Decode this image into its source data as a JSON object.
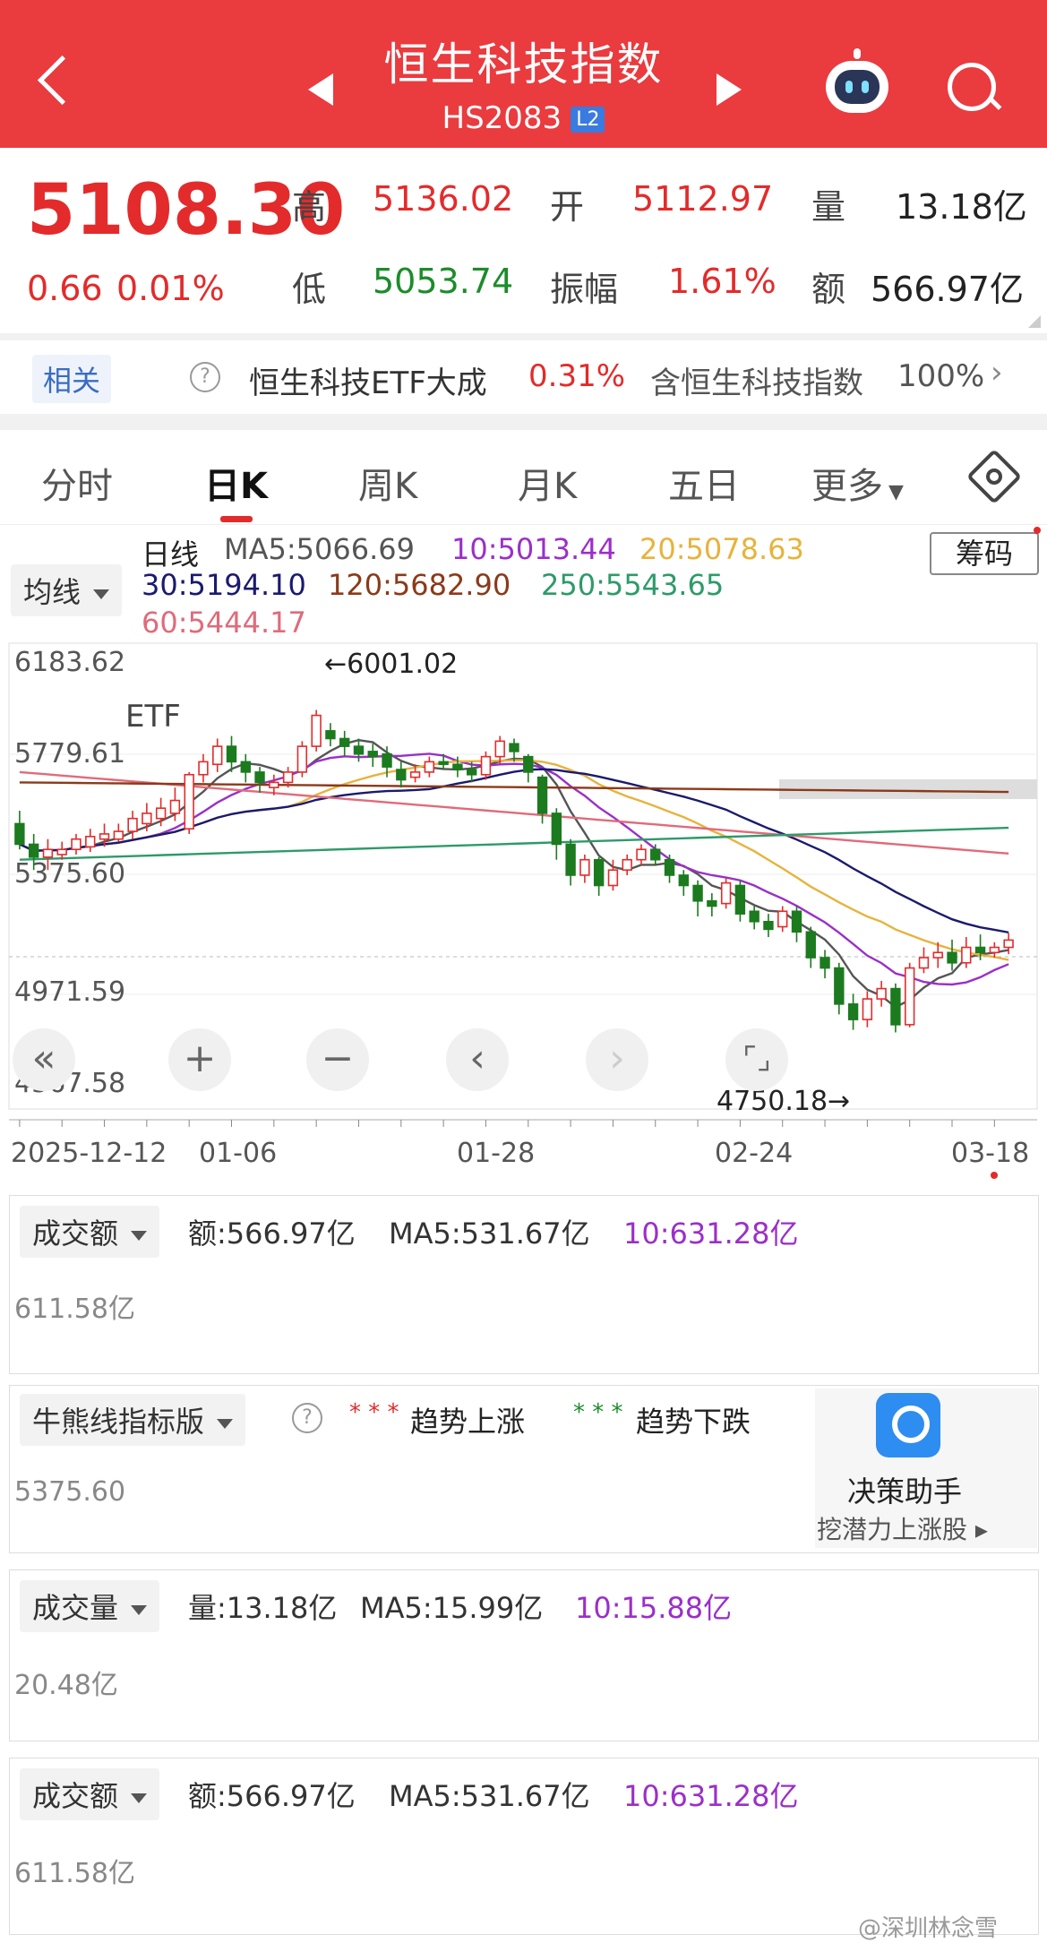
{
  "header": {
    "title": "恒生科技指数",
    "code": "HS2083",
    "badge": "L2"
  },
  "quote": {
    "price": "5108.30",
    "change": "0.66",
    "change_pct": "0.01%",
    "high_label": "高",
    "high": "5136.02",
    "open_label": "开",
    "open": "5112.97",
    "vol_label": "量",
    "vol": "13.18亿",
    "low_label": "低",
    "low": "5053.74",
    "amp_label": "振幅",
    "amp": "1.61%",
    "amt_label": "额",
    "amt": "566.97亿"
  },
  "etf": {
    "tag": "相关",
    "etf_label": "ETF",
    "help": "?",
    "name": "恒生科技ETF大成",
    "pct": "0.31%",
    "contains": "含恒生科技指数",
    "weight": "100%"
  },
  "tabs": [
    "分时",
    "日K",
    "周K",
    "月K",
    "五日",
    "更多"
  ],
  "ma_panel": {
    "dropdown": "均线",
    "chip": "筹码",
    "row1": {
      "day": "日线",
      "ma5": "MA5:5066.69",
      "ma10": "10:5013.44",
      "ma20": "20:5078.63"
    },
    "row2": {
      "ma30": "30:5194.10",
      "ma120": "120:5682.90",
      "ma250": "250:5543.65"
    },
    "row3": {
      "ma60": "60:5444.17"
    }
  },
  "kline": {
    "y_labels": [
      "6183.62",
      "5779.61",
      "5375.60",
      "4971.59",
      "4567.58"
    ],
    "max_note": "←6001.02",
    "min_note": "4750.18→",
    "x_labels": [
      "2025-12-12",
      "01-06",
      "01-28",
      "02-24",
      "03-18"
    ],
    "buttons": [
      "«",
      "+",
      "−",
      "‹",
      "›",
      "⌜⌟"
    ]
  },
  "amount_panel": {
    "dropdown": "成交额",
    "amt": "额:566.97亿",
    "ma5": "MA5:531.67亿",
    "ma10": "10:631.28亿",
    "level": "611.58亿"
  },
  "bull_panel": {
    "dropdown": "牛熊线指标版",
    "help": "?",
    "up": "趋势上涨",
    "down": "趋势下跌",
    "level": "5375.60",
    "assist_title": "决策助手",
    "assist_sub": "挖潜力上涨股 ▸"
  },
  "volume_panel": {
    "dropdown": "成交量",
    "vol": "量:13.18亿",
    "ma5": "MA5:15.99亿",
    "ma10": "10:15.88亿",
    "level": "20.48亿"
  },
  "amount_panel2": {
    "dropdown": "成交额",
    "amt": "额:566.97亿",
    "ma5": "MA5:531.67亿",
    "ma10": "10:631.28亿",
    "level": "611.58亿"
  },
  "watermark": "@深圳林念雪",
  "colors": {
    "up": "#e32b2b",
    "down": "#1c7a1f",
    "ma5": "#555555",
    "ma10": "#9b2fc9",
    "ma20": "#e7b33d",
    "ma30": "#1a1a6e",
    "ma60": "#e06b7a",
    "ma120": "#8b3a1a",
    "ma250": "#2e9a6a"
  },
  "chart_data": {
    "type": "candlestick",
    "title": "恒生科技指数 日K",
    "ylim": [
      4567.58,
      6183.62
    ],
    "candles": [
      [
        5560,
        5480,
        5610,
        5460
      ],
      [
        5480,
        5430,
        5520,
        5380
      ],
      [
        5430,
        5460,
        5500,
        5380
      ],
      [
        5440,
        5460,
        5490,
        5420
      ],
      [
        5460,
        5500,
        5520,
        5440
      ],
      [
        5470,
        5510,
        5540,
        5450
      ],
      [
        5500,
        5520,
        5560,
        5470
      ],
      [
        5500,
        5530,
        5560,
        5490
      ],
      [
        5530,
        5580,
        5610,
        5500
      ],
      [
        5560,
        5600,
        5640,
        5530
      ],
      [
        5580,
        5620,
        5660,
        5550
      ],
      [
        5600,
        5650,
        5700,
        5570
      ],
      [
        5540,
        5750,
        5760,
        5520
      ],
      [
        5750,
        5800,
        5830,
        5720
      ],
      [
        5790,
        5860,
        5890,
        5760
      ],
      [
        5860,
        5800,
        5900,
        5760
      ],
      [
        5800,
        5760,
        5830,
        5720
      ],
      [
        5760,
        5720,
        5780,
        5680
      ],
      [
        5700,
        5720,
        5750,
        5670
      ],
      [
        5720,
        5760,
        5780,
        5700
      ],
      [
        5760,
        5860,
        5880,
        5740
      ],
      [
        5860,
        5980,
        6001,
        5840
      ],
      [
        5920,
        5890,
        5950,
        5860
      ],
      [
        5890,
        5860,
        5920,
        5820
      ],
      [
        5860,
        5830,
        5890,
        5800
      ],
      [
        5840,
        5820,
        5870,
        5780
      ],
      [
        5830,
        5780,
        5860,
        5740
      ],
      [
        5770,
        5730,
        5800,
        5700
      ],
      [
        5740,
        5760,
        5790,
        5720
      ],
      [
        5760,
        5800,
        5820,
        5740
      ],
      [
        5800,
        5790,
        5830,
        5770
      ],
      [
        5790,
        5770,
        5820,
        5740
      ],
      [
        5770,
        5750,
        5800,
        5720
      ],
      [
        5750,
        5820,
        5840,
        5730
      ],
      [
        5820,
        5880,
        5900,
        5790
      ],
      [
        5870,
        5840,
        5890,
        5800
      ],
      [
        5820,
        5760,
        5830,
        5720
      ],
      [
        5740,
        5600,
        5750,
        5560
      ],
      [
        5600,
        5480,
        5620,
        5420
      ],
      [
        5480,
        5360,
        5500,
        5320
      ],
      [
        5360,
        5420,
        5440,
        5330
      ],
      [
        5420,
        5320,
        5430,
        5280
      ],
      [
        5320,
        5380,
        5420,
        5300
      ],
      [
        5380,
        5420,
        5440,
        5360
      ],
      [
        5420,
        5460,
        5480,
        5400
      ],
      [
        5460,
        5420,
        5480,
        5400
      ],
      [
        5420,
        5360,
        5440,
        5330
      ],
      [
        5360,
        5320,
        5380,
        5280
      ],
      [
        5320,
        5260,
        5340,
        5200
      ],
      [
        5260,
        5240,
        5290,
        5200
      ],
      [
        5250,
        5330,
        5350,
        5230
      ],
      [
        5320,
        5210,
        5340,
        5180
      ],
      [
        5220,
        5180,
        5240,
        5150
      ],
      [
        5180,
        5150,
        5210,
        5120
      ],
      [
        5160,
        5220,
        5240,
        5140
      ],
      [
        5220,
        5140,
        5240,
        5100
      ],
      [
        5140,
        5040,
        5160,
        5000
      ],
      [
        5040,
        5000,
        5070,
        4960
      ],
      [
        5000,
        4860,
        5020,
        4820
      ],
      [
        4860,
        4800,
        4900,
        4760
      ],
      [
        4800,
        4880,
        4910,
        4770
      ],
      [
        4880,
        4920,
        4950,
        4850
      ],
      [
        4920,
        4780,
        4940,
        4750
      ],
      [
        4780,
        5000,
        5020,
        4770
      ],
      [
        5000,
        5040,
        5080,
        4980
      ],
      [
        5040,
        5060,
        5100,
        5000
      ],
      [
        5060,
        5020,
        5110,
        4990
      ],
      [
        5020,
        5080,
        5120,
        5000
      ],
      [
        5080,
        5060,
        5130,
        5030
      ],
      [
        5060,
        5080,
        5100,
        5040
      ],
      [
        5080,
        5108.3,
        5136.02,
        5053.74
      ]
    ]
  }
}
